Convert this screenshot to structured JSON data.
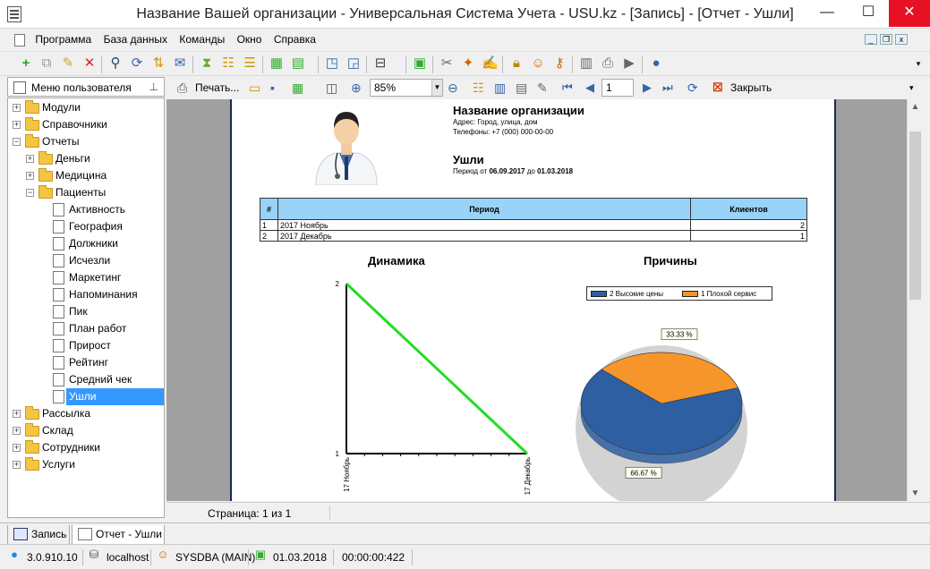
{
  "window": {
    "title": "Название Вашей организации - Универсальная Система Учета - USU.kz - [Запись] - [Отчет - Ушли]",
    "minimize": "—",
    "maximize": "☐",
    "close": "✕"
  },
  "menu": {
    "items": [
      "Программа",
      "База данных",
      "Команды",
      "Окно",
      "Справка"
    ]
  },
  "sidebar": {
    "header": "Меню пользователя",
    "tree": [
      {
        "label": "Модули",
        "level": 0,
        "type": "folder",
        "expander": "+"
      },
      {
        "label": "Справочники",
        "level": 0,
        "type": "folder",
        "expander": "+"
      },
      {
        "label": "Отчеты",
        "level": 0,
        "type": "folder",
        "expander": "−"
      },
      {
        "label": "Деньги",
        "level": 1,
        "type": "folder",
        "expander": "+"
      },
      {
        "label": "Медицина",
        "level": 1,
        "type": "folder",
        "expander": "+"
      },
      {
        "label": "Пациенты",
        "level": 1,
        "type": "folder",
        "expander": "−"
      },
      {
        "label": "Активность",
        "level": 2,
        "type": "doc"
      },
      {
        "label": "География",
        "level": 2,
        "type": "doc"
      },
      {
        "label": "Должники",
        "level": 2,
        "type": "doc"
      },
      {
        "label": "Исчезли",
        "level": 2,
        "type": "doc"
      },
      {
        "label": "Маркетинг",
        "level": 2,
        "type": "doc"
      },
      {
        "label": "Напоминания",
        "level": 2,
        "type": "doc"
      },
      {
        "label": "Пик",
        "level": 2,
        "type": "doc"
      },
      {
        "label": "План работ",
        "level": 2,
        "type": "doc"
      },
      {
        "label": "Прирост",
        "level": 2,
        "type": "doc"
      },
      {
        "label": "Рейтинг",
        "level": 2,
        "type": "doc"
      },
      {
        "label": "Средний чек",
        "level": 2,
        "type": "doc"
      },
      {
        "label": "Ушли",
        "level": 2,
        "type": "doc",
        "selected": true
      },
      {
        "label": "Рассылка",
        "level": 0,
        "type": "folder",
        "expander": "+"
      },
      {
        "label": "Склад",
        "level": 0,
        "type": "folder",
        "expander": "+"
      },
      {
        "label": "Сотрудники",
        "level": 0,
        "type": "folder",
        "expander": "+"
      },
      {
        "label": "Услуги",
        "level": 0,
        "type": "folder",
        "expander": "+"
      }
    ]
  },
  "report_toolbar": {
    "print": "Печать...",
    "zoom": "85%",
    "page": "1",
    "close": "Закрыть"
  },
  "report": {
    "org_name": "Название организации",
    "address": "Адрес: Город, улица, дом",
    "phones": "Телефоны: +7 (000) 000-00-00",
    "report_title": "Ушли",
    "period_prefix": "Период от ",
    "period_from": "06.09.2017",
    "period_mid": " до ",
    "period_to": "01.03.2018",
    "table": {
      "headers": [
        "#",
        "Период",
        "Клиентов"
      ],
      "rows": [
        [
          "1",
          "2017 Ноябрь",
          "2"
        ],
        [
          "2",
          "2017 Декабрь",
          "1"
        ]
      ]
    }
  },
  "chart_data": [
    {
      "type": "line",
      "title": "Динамика",
      "categories": [
        "17 Ноябрь",
        "17 Декабрь"
      ],
      "series": [
        {
          "values": [
            2,
            1
          ],
          "color": "#22dd22"
        }
      ],
      "yticks": [
        "2",
        "1"
      ],
      "ylim": [
        1,
        2
      ]
    },
    {
      "type": "pie",
      "title": "Причины",
      "series": [
        {
          "name": "2 Высокие цены",
          "value": 66.67,
          "label": "66.67 %",
          "color": "#2e5fa3"
        },
        {
          "name": "1 Плохой сервис",
          "value": 33.33,
          "label": "33.33 %",
          "color": "#f6952a"
        }
      ],
      "legend": "top"
    }
  ],
  "page_status": "Страница: 1 из 1",
  "window_tabs": [
    "Запись",
    "Отчет - Ушли"
  ],
  "status": {
    "version": "3.0.910.10",
    "host": "localhost",
    "user": "SYSDBA (MAIN)",
    "date": "01.03.2018",
    "timer": "00:00:00:422"
  }
}
